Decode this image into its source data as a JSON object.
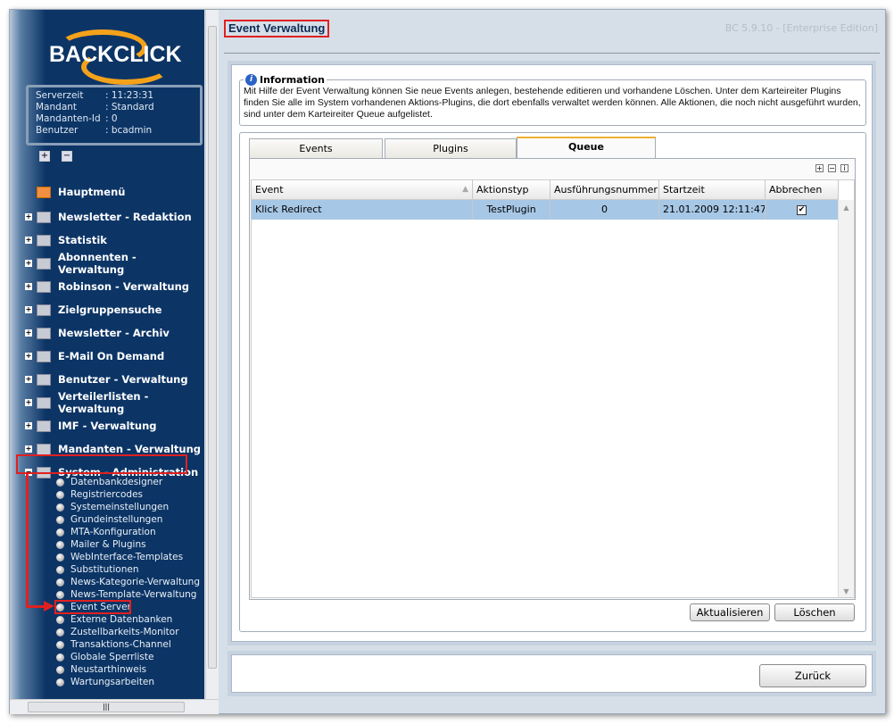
{
  "logo": {
    "text": "BACKCLICK"
  },
  "server_info": [
    {
      "key": "Serverzeit",
      "value": ": 11:23:31"
    },
    {
      "key": "Mandant",
      "value": ": Standard"
    },
    {
      "key": "Mandanten-Id",
      "value": ": 0"
    },
    {
      "key": "Benutzer",
      "value": ": bcadmin"
    }
  ],
  "sidebar": {
    "expand_all": "+",
    "collapse_all": "−",
    "items": [
      "Hauptmenü",
      "Newsletter - Redaktion",
      "Statistik",
      "Abonnenten - Verwaltung",
      "Robinson - Verwaltung",
      "Zielgruppensuche",
      "Newsletter - Archiv",
      "E-Mail On Demand",
      "Benutzer - Verwaltung",
      "Verteilerlisten - Verwaltung",
      "IMF - Verwaltung",
      "Mandanten - Verwaltung",
      "System - Administration"
    ],
    "subitems": [
      "Datenbankdesigner",
      "Registriercodes",
      "Systemeinstellungen",
      "Grundeinstellungen",
      "MTA-Konfiguration",
      "Mailer & Plugins",
      "WebInterface-Templates",
      "Substitutionen",
      "News-Kategorie-Verwaltung",
      "News-Template-Verwaltung",
      "Event Server",
      "Externe Datenbanken",
      "Zustellbarkeits-Monitor",
      "Transaktions-Channel",
      "Globale Sperrliste",
      "Neustarthinweis",
      "Wartungsarbeiten"
    ],
    "selected": "Event Server",
    "highlight_color": "#e02020"
  },
  "header": {
    "title": "Event Verwaltung",
    "version": "BC 5.9.10 - [Enterprise Edition]"
  },
  "information": {
    "legend": "Information",
    "text": "Mit Hilfe der Event Verwaltung können Sie neue Events anlegen, bestehende editieren und vorhandene Löschen. Unter dem Karteireiter Plugins finden Sie alle im System vorhandenen Aktions-Plugins, die dort ebenfalls verwaltet werden können. Alle Aktionen, die noch nicht ausgeführt wurden, sind unter dem Karteireiter Queue aufgelistet."
  },
  "tabs": [
    {
      "label": "Events"
    },
    {
      "label": "Plugins"
    },
    {
      "label": "Queue",
      "active": true
    }
  ],
  "grid": {
    "columns": [
      "Event",
      "Aktionstyp",
      "Ausführungsnummer",
      "Startzeit",
      "Abbrechen"
    ],
    "rows": [
      {
        "event": "Klick Redirect",
        "aktionstyp": "TestPlugin",
        "nummer": "0",
        "startzeit": "21.01.2009 12:11:47",
        "abbrechen": true
      }
    ]
  },
  "buttons": {
    "refresh": "Aktualisieren",
    "delete": "Löschen",
    "back": "Zurück"
  }
}
